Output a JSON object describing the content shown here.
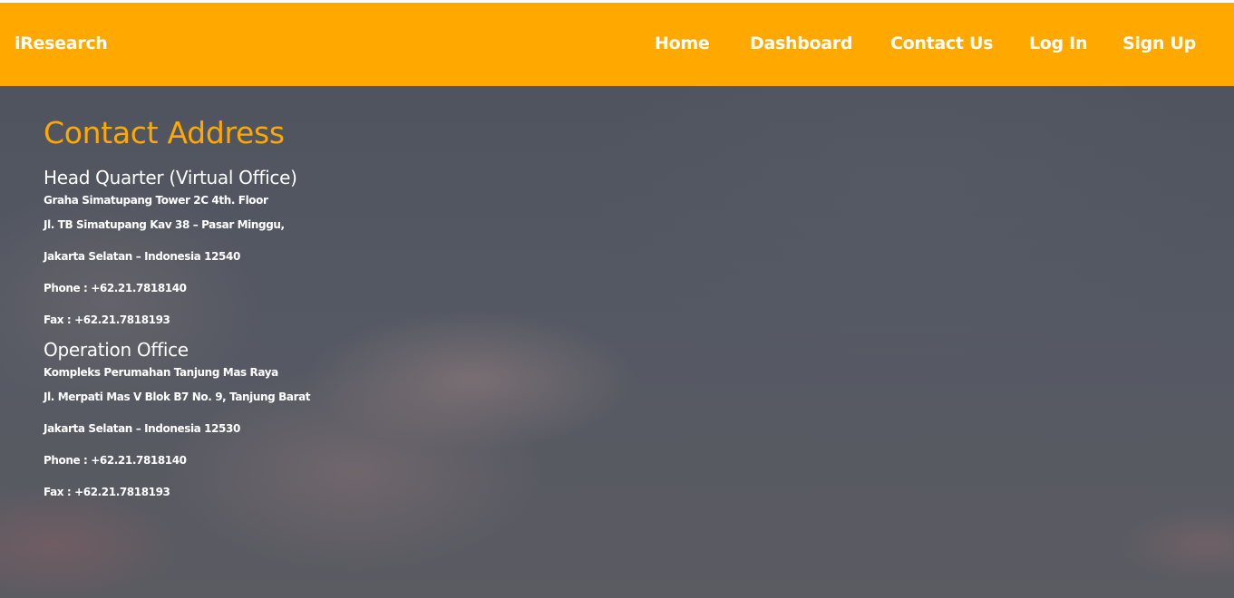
{
  "header": {
    "brand": "iResearch",
    "nav": {
      "home": "Home",
      "dashboard": "Dashboard",
      "contact": "Contact Us",
      "login": "Log In",
      "signup": "Sign Up"
    },
    "color": "#ffa800"
  },
  "main": {
    "title": "Contact Address",
    "head_quarter": {
      "heading": "Head Quarter (Virtual Office)",
      "lines": [
        "Graha Simatupang Tower 2C 4th. Floor",
        "Jl. TB Simatupang Kav 38 – Pasar Minggu,",
        "Jakarta Selatan – Indonesia 12540",
        "Phone : +62.21.7818140",
        "Fax : +62.21.7818193"
      ]
    },
    "operation_office": {
      "heading": "Operation Office",
      "lines": [
        "Kompleks Perumahan Tanjung Mas Raya",
        "Jl. Merpati Mas V Blok B7 No. 9, Tanjung Barat",
        "Jakarta Selatan – Indonesia 12530",
        "Phone : +62.21.7818140",
        "Fax : +62.21.7818193"
      ]
    }
  }
}
